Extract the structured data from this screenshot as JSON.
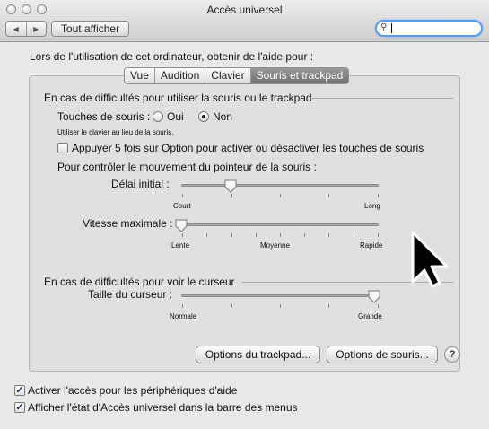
{
  "window": {
    "title": "Accès universel"
  },
  "toolbar": {
    "back_icon": "back-arrow-icon",
    "forward_icon": "forward-arrow-icon",
    "show_all": "Tout afficher",
    "search": {
      "value": "",
      "icon": "magnifier-icon"
    }
  },
  "intro": "Lors de l'utilisation de cet ordinateur, obtenir de l'aide pour :",
  "tabs": [
    {
      "label": "Vue",
      "selected": false
    },
    {
      "label": "Audition",
      "selected": false
    },
    {
      "label": "Clavier",
      "selected": false
    },
    {
      "label": "Souris et trackpad",
      "selected": true
    }
  ],
  "mouse_section": {
    "heading": "En cas de difficultés pour utiliser la souris ou le trackpad",
    "mouse_keys_label": "Touches de souris :",
    "radio_oui": {
      "label": "Oui",
      "selected": false
    },
    "radio_non": {
      "label": "Non",
      "selected": true
    },
    "hint": "Utiliser le clavier au lieu de la souris.",
    "option_checkbox": {
      "label": "Appuyer 5 fois sur Option pour activer ou désactiver les touches de souris",
      "checked": false
    },
    "control_heading": "Pour contrôler le mouvement du pointeur de la souris :",
    "initial_delay": {
      "label": "Délai initial :",
      "min_label": "Court",
      "max_label": "Long",
      "value_fraction": 0.25
    },
    "max_speed": {
      "label": "Vitesse maximale :",
      "min_label": "Lente",
      "mid_label": "Moyenne",
      "max_label": "Rapide",
      "value_fraction": 0.0
    }
  },
  "cursor_section": {
    "heading": "En cas de difficultés pour voir le curseur",
    "cursor_size": {
      "label": "Taille du curseur :",
      "min_label": "Normale",
      "max_label": "Grande",
      "value_fraction": 1.0
    }
  },
  "buttons": {
    "trackpad_options": "Options du trackpad...",
    "mouse_options": "Options de souris...",
    "help": "?"
  },
  "footer": {
    "assistive_devices": {
      "label": "Activer l'accès pour les périphériques d'aide",
      "checked": true
    },
    "menu_bar_status": {
      "label": "Afficher l'état d'Accès universel dans la barre des menus",
      "checked": true
    }
  },
  "colors": {
    "accent": "#5b9be8",
    "selected_tab": "#7d7d7d",
    "checkmark": "#12315c"
  }
}
